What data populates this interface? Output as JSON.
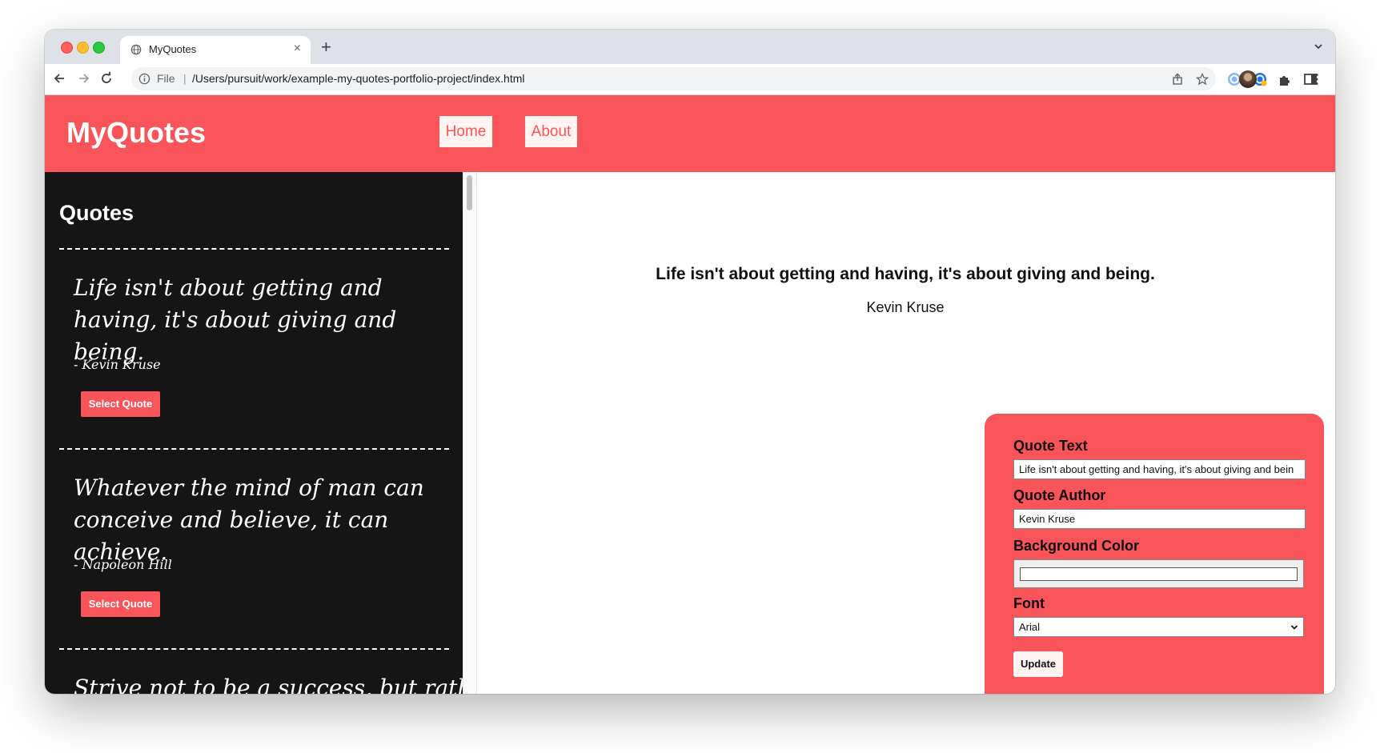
{
  "browser": {
    "tab_title": "MyQuotes",
    "close_glyph": "×",
    "new_tab_glyph": "+",
    "address_prefix": "File",
    "address_separator": "|",
    "url": "/Users/pursuit/work/example-my-quotes-portfolio-project/index.html",
    "icons": [
      "globe-icon",
      "back-icon",
      "forward-icon",
      "reload-icon",
      "info-icon",
      "share-icon",
      "star-icon",
      "extension-icons",
      "puzzle-icon",
      "sidepanel-icon",
      "avatar",
      "menu-icon"
    ]
  },
  "site": {
    "brand": "MyQuotes",
    "nav": [
      {
        "label": "Home"
      },
      {
        "label": "About"
      }
    ],
    "accent_color": "#f9545a",
    "sidebar_color": "#151515"
  },
  "sidebar": {
    "heading": "Quotes",
    "quotes": [
      {
        "text": "Life isn't about getting and having, it's about giving and being.",
        "author": "- Kevin Kruse",
        "button": "Select Quote"
      },
      {
        "text": "Whatever the mind of man can conceive and believe, it can achieve.",
        "author": "- Napoleon Hill",
        "button": "Select Quote"
      },
      {
        "text": "Strive not to be a success, but rather",
        "author": "",
        "button": ""
      }
    ]
  },
  "display": {
    "quote": "Life isn't about getting and having, it's about giving and being.",
    "author": "Kevin Kruse"
  },
  "form": {
    "text_label": "Quote Text",
    "text_value": "Life isn't about getting and having, it's about giving and bein",
    "author_label": "Quote Author",
    "author_value": "Kevin Kruse",
    "bg_label": "Background Color",
    "bg_value": "#ffffff",
    "font_label": "Font",
    "font_value": "Arial",
    "update_label": "Update"
  }
}
